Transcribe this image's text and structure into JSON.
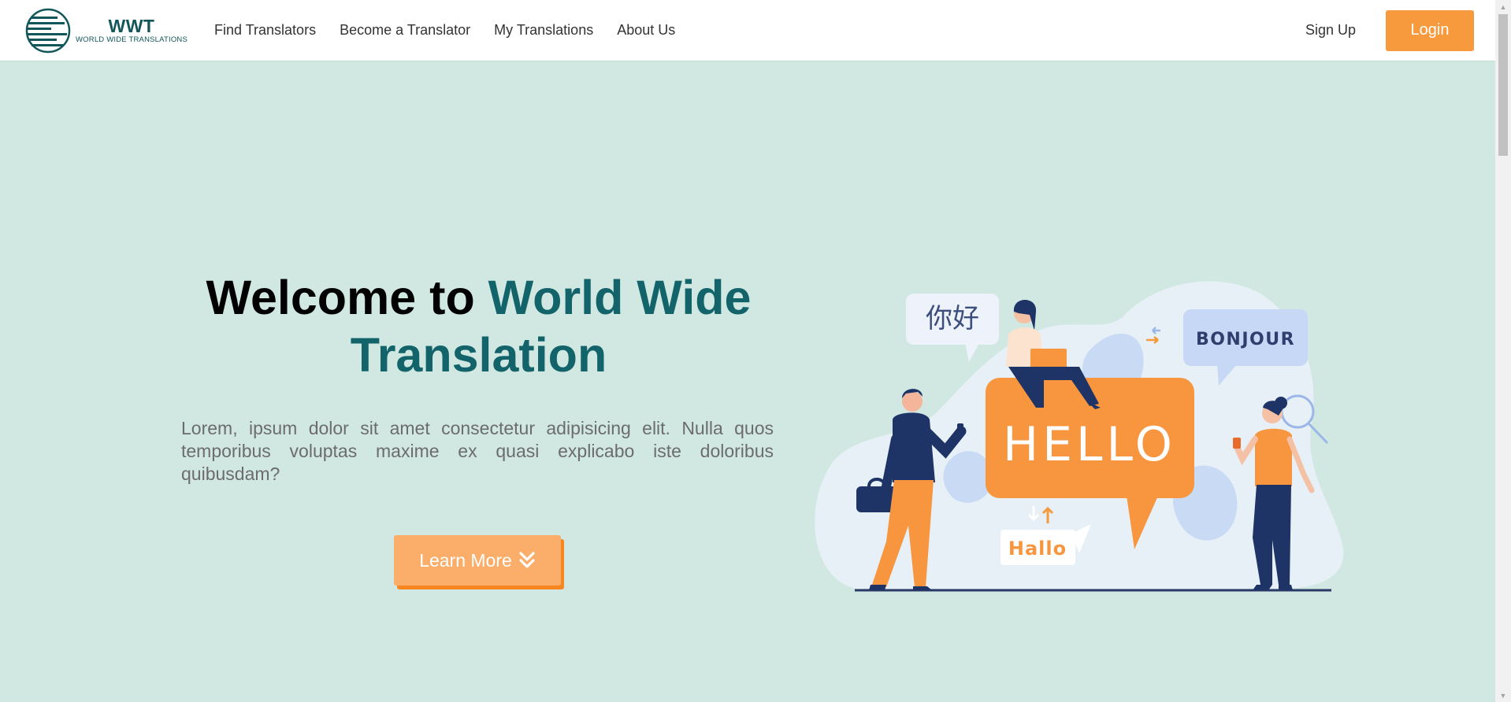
{
  "brand": {
    "title": "WWT",
    "subtitle": "WORLD WIDE TRANSLATIONS"
  },
  "nav": {
    "links": [
      {
        "label": "Find Translators"
      },
      {
        "label": "Become a Translator"
      },
      {
        "label": "My Translations"
      },
      {
        "label": "About Us"
      }
    ],
    "signup_label": "Sign Up",
    "login_label": "Login"
  },
  "hero": {
    "title_part1": "Welcome to",
    "title_part2": "World Wide",
    "title_part3": "Translation",
    "body": "Lorem, ipsum dolor sit amet consectetur adipisicing elit. Nulla quos temporibus voluptas maxime ex quasi explicabo iste doloribus quibusdam?",
    "button_label": "Learn More",
    "button_icon": "double-chevron-down-icon"
  },
  "illustration": {
    "bubble_chinese": "你好",
    "bubble_french": "BONJOUR",
    "bubble_english": "HELLO",
    "bubble_german": "Hallo"
  },
  "colors": {
    "background": "#d1e8e2",
    "brand_teal": "#12636a",
    "accent_orange": "#f79a3e",
    "button_orange": "#fbad6a"
  }
}
